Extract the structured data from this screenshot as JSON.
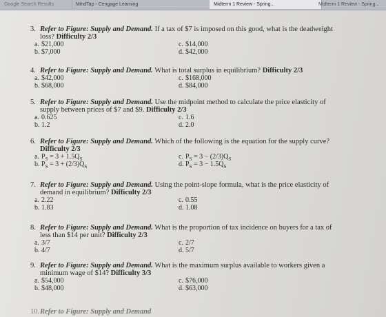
{
  "browser_tabs": [
    "Google Search Results",
    "MindTap - Cengage Learning",
    "Midterm 1 Review - Spring...",
    "Midterm 1 Review - Spring..."
  ],
  "questions": [
    {
      "number": "3.",
      "ref": "Refer to Figure: Supply and Demand.",
      "text": " If a tax of $7 is imposed on this good, what is the deadweight loss? ",
      "difficulty": "Difficulty 2/3",
      "choices": {
        "a": "$21,000",
        "b": "$7,000",
        "c": "$14,000",
        "d": "$42,000"
      }
    },
    {
      "number": "4.",
      "ref": "Refer to Figure: Supply and Demand.",
      "text": " What is total surplus in equilibrium? ",
      "difficulty": "Difficulty 2/3",
      "choices": {
        "a": "$42,000",
        "b": "$68,000",
        "c": "$168,000",
        "d": "$84,000"
      }
    },
    {
      "number": "5.",
      "ref": "Refer to Figure: Supply and Demand.",
      "text": " Use the midpoint method to calculate the price elasticity of supply between prices of $7 and $9. ",
      "difficulty": "Difficulty 2/3",
      "choices": {
        "a": "0.625",
        "b": "1.2",
        "c": "1.6",
        "d": "2.0"
      }
    },
    {
      "number": "6.",
      "ref": "Refer to Figure: Supply and Demand.",
      "text": " Which of the following is the equation for the supply curve? ",
      "difficulty": "Difficulty 2/3",
      "choices": {
        "a": [
          "P",
          "S",
          " = 3 + 1.5Q",
          "S",
          ""
        ],
        "b": [
          "P",
          "S",
          " = 3 + (2/3)Q",
          "S",
          ""
        ],
        "c": [
          "P",
          "S",
          " = 3 − (2/3)Q",
          "S",
          ""
        ],
        "d": [
          "P",
          "S",
          " = 3 − 1.5Q",
          "S",
          ""
        ]
      }
    },
    {
      "number": "7.",
      "ref": "Refer to Figure: Supply and Demand.",
      "text": " Using the point-slope formula, what is the price elasticity of demand in equilibrium? ",
      "difficulty": "Difficulty 2/3",
      "choices": {
        "a": "2.22",
        "b": "1.83",
        "c": "0.55",
        "d": "1.08"
      }
    },
    {
      "number": "8.",
      "ref": "Refer to Figure: Supply and Demand.",
      "text": " What is the proportion of tax incidence on buyers for a tax of less than $14 per unit? ",
      "difficulty": "Difficulty 2/3",
      "choices": {
        "a": "3/7",
        "b": "4/7",
        "c": "2/7",
        "d": "5/7"
      }
    },
    {
      "number": "9.",
      "ref": "Refer to Figure: Supply and Demand.",
      "text": " What is the maximum surplus available to workers given a minimum wage of $14? ",
      "difficulty": "Difficulty 3/3",
      "choices": {
        "a": "$54,000",
        "b": "$48,000",
        "c": "$76,000",
        "d": "$63,000"
      }
    }
  ],
  "partial_question": {
    "number": "10.",
    "ref": "Refer to Figure: Supply and Demand"
  }
}
